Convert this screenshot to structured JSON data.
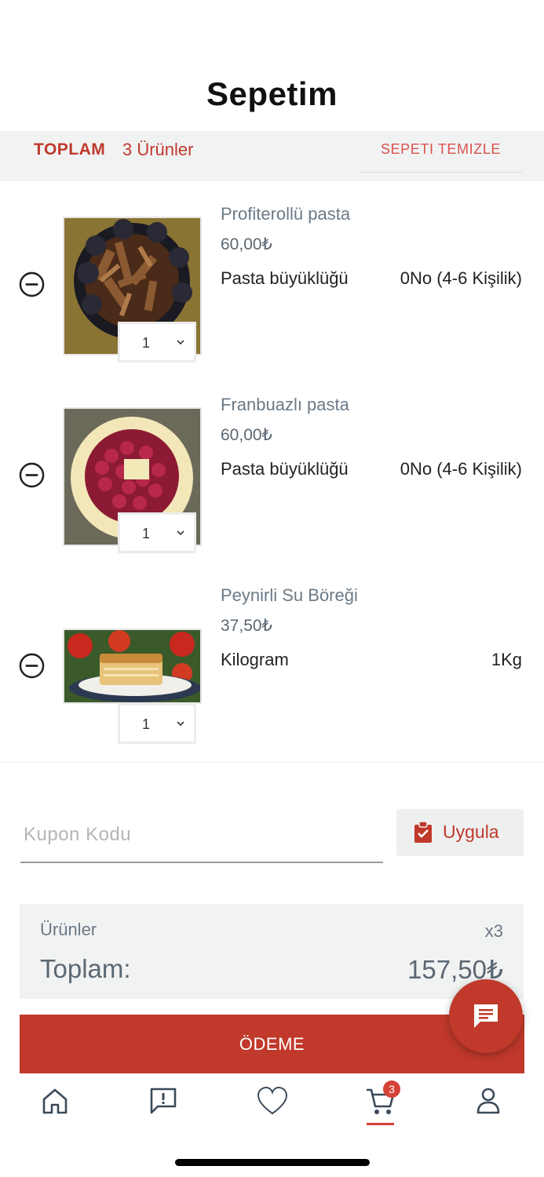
{
  "header": {
    "title": "Sepetim"
  },
  "summary": {
    "total_label": "TOPLAM",
    "count_label": "3 Ürünler",
    "clear_label": "SEPETI TEMIZLE"
  },
  "items": [
    {
      "name": "Profiterollü pasta",
      "price": "60,00₺",
      "option_label": "Pasta büyüklüğü",
      "option_value": "0No (4-6 Kişilik)",
      "quantity": "1"
    },
    {
      "name": "Franbuazlı pasta",
      "price": "60,00₺",
      "option_label": "Pasta büyüklüğü",
      "option_value": "0No (4-6 Kişilik)",
      "quantity": "1"
    },
    {
      "name": "Peynirli Su Böreği",
      "price": "37,50₺",
      "option_label": "Kilogram",
      "option_value": "1Kg",
      "quantity": "1"
    }
  ],
  "coupon": {
    "placeholder": "Kupon Kodu",
    "apply_label": "Uygula"
  },
  "totals": {
    "items_label": "Ürünler",
    "items_count": "x3",
    "total_label": "Toplam:",
    "total_value": "157,50₺"
  },
  "checkout": {
    "label": "ÖDEME"
  },
  "tabbar": {
    "cart_badge": "3",
    "active_tab": "cart"
  },
  "colors": {
    "accent": "#c0392b",
    "bar_bg": "#f1f2f2"
  }
}
